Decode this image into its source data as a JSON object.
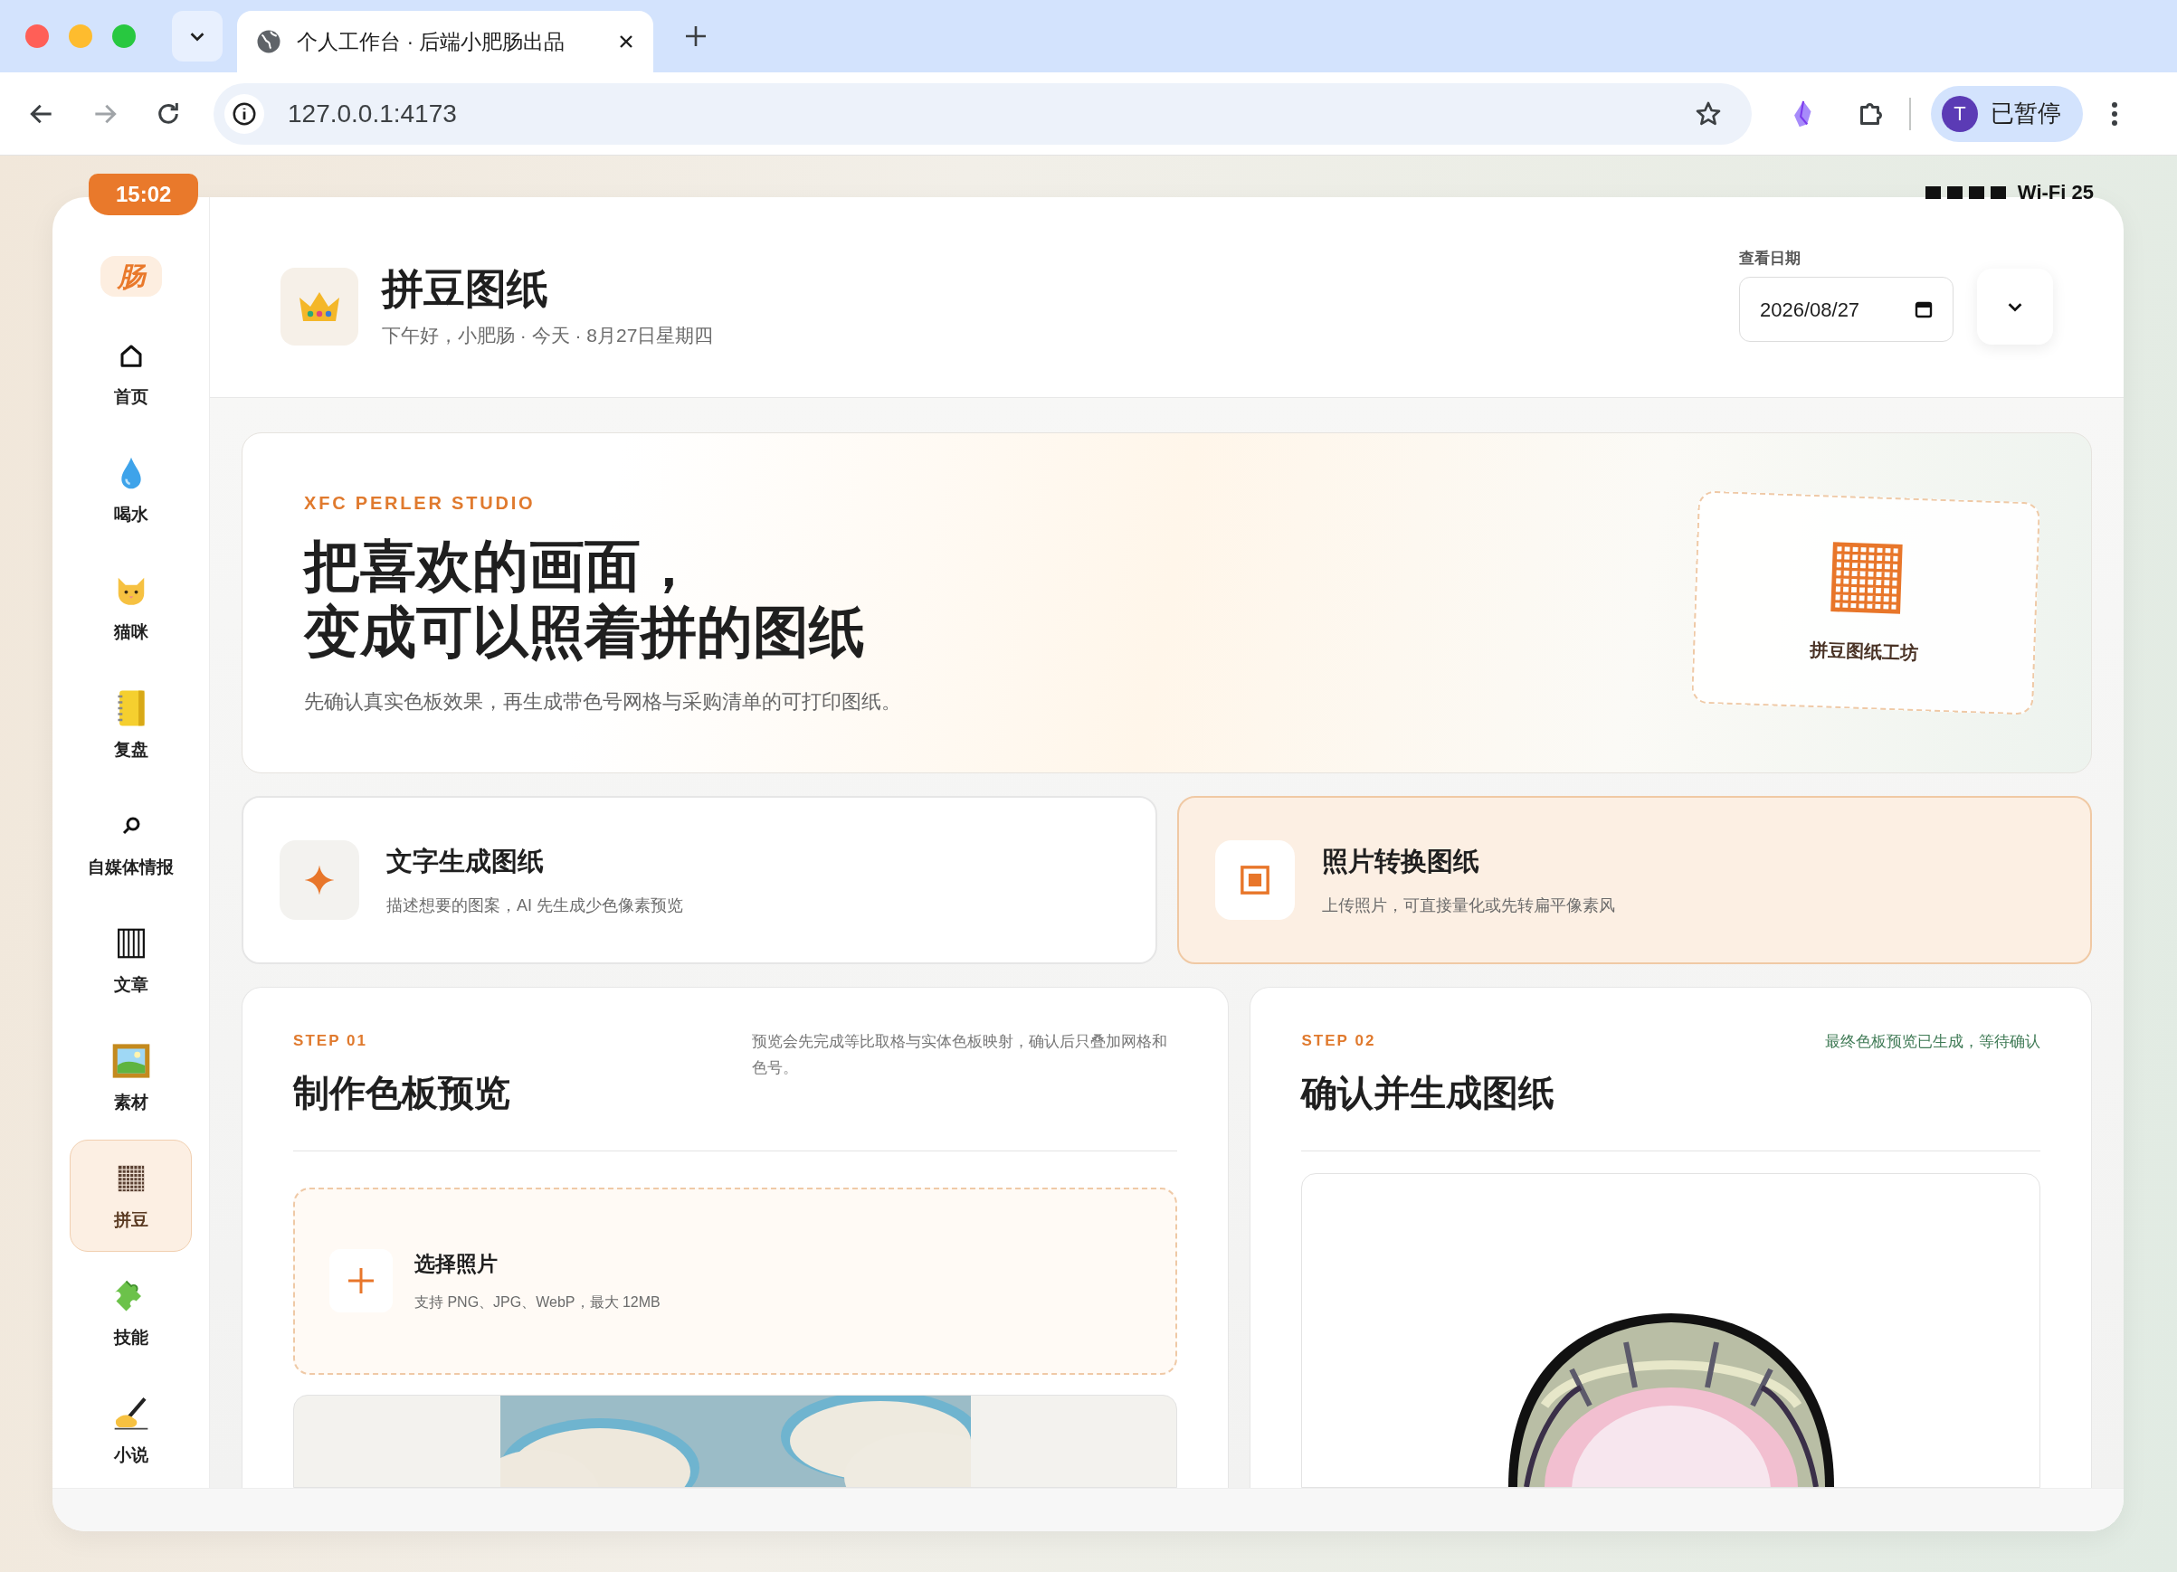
{
  "browser": {
    "tabs": [
      {
        "title": "个人工作台 · 后端小肥肠出品",
        "selected": true
      }
    ],
    "address": "127.0.0.1:4173",
    "profile": {
      "initial": "T",
      "label": "已暂停"
    }
  },
  "status": {
    "time": "15:02",
    "wifi": "Wi-Fi 25"
  },
  "sidebar": {
    "logo": "肠",
    "items": [
      {
        "label": "首页",
        "selected": false
      },
      {
        "label": "喝水",
        "selected": false
      },
      {
        "label": "猫咪",
        "selected": false
      },
      {
        "label": "复盘",
        "selected": false
      },
      {
        "label": "自媒体情报",
        "selected": false
      },
      {
        "label": "文章",
        "selected": false
      },
      {
        "label": "素材",
        "selected": false
      },
      {
        "label": "拼豆",
        "selected": true
      },
      {
        "label": "技能",
        "selected": false
      },
      {
        "label": "小说",
        "selected": false
      }
    ]
  },
  "header": {
    "title": "拼豆图纸",
    "subtitle": "下午好，小肥肠 · 今天 · 8月27日星期四",
    "date_label": "查看日期",
    "date_value": "2026/08/27"
  },
  "hero": {
    "eyebrow": "XFC PERLER STUDIO",
    "title_lines": [
      "把喜欢的画面，",
      "变成可以照着拼的图纸"
    ],
    "description": "先确认真实色板效果，再生成带色号网格与采购清单的可打印图纸。",
    "badge_label": "拼豆图纸工坊"
  },
  "modes": [
    {
      "title": "文字生成图纸",
      "description": "描述想要的图案，AI 先生成少色像素预览",
      "selected": false
    },
    {
      "title": "照片转换图纸",
      "description": "上传照片，可直接量化或先转扁平像素风",
      "selected": true
    }
  ],
  "steps": [
    {
      "step": "STEP 01",
      "title": "制作色板预览",
      "note": "预览会先完成等比取格与实体色板映射，确认后只叠加网格和色号。",
      "kind": "info"
    },
    {
      "step": "STEP 02",
      "title": "确认并生成图纸",
      "note": "最终色板预览已生成，等待确认",
      "kind": "status"
    }
  ],
  "upload": {
    "title": "选择照片",
    "hint": "支持 PNG、JPG、WebP，最大 12MB"
  }
}
